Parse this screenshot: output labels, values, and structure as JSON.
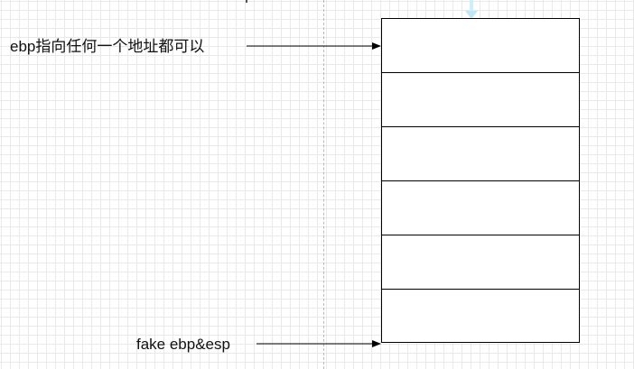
{
  "annotations": {
    "top_label": "ebp指向任何一个地址都可以",
    "bottom_label": "fake ebp&esp"
  },
  "stack": {
    "cells": [
      "",
      "",
      "",
      "",
      "",
      ""
    ]
  },
  "colors": {
    "grid": "#e9e9e9",
    "line": "#000000",
    "guide": "#b9b9b9",
    "selection_arrow": "#bfe6f5"
  }
}
